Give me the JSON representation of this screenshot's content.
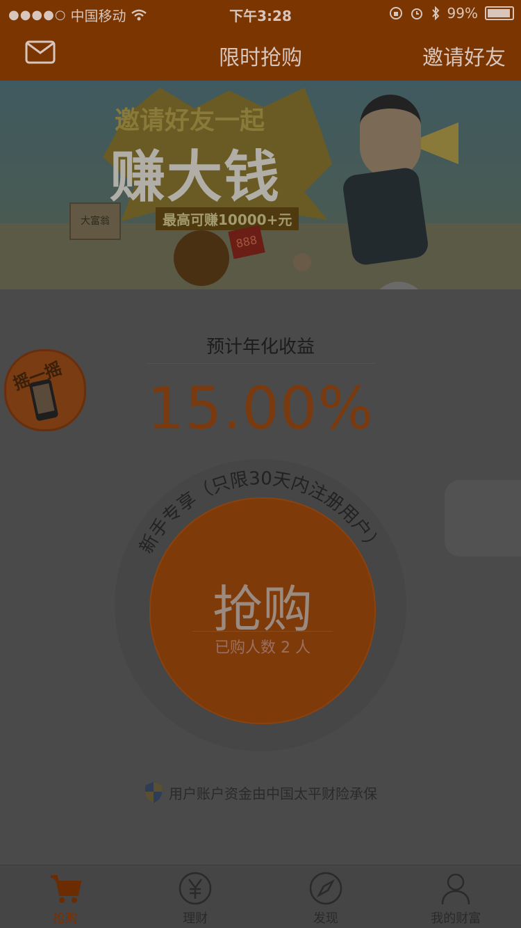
{
  "status_bar": {
    "signal": "●●●●○",
    "carrier": "中国移动",
    "time": "下午3:28",
    "battery_percent": "99%"
  },
  "nav": {
    "title": "限时抢购",
    "right_label": "邀请好友",
    "mail_icon": "mail-icon"
  },
  "banner": {
    "headline_top": "邀请好友一起",
    "headline_main": "赚大钱",
    "subline": "最高可赚10000+元",
    "sign_text": "大富翁",
    "card_text": "888"
  },
  "yield": {
    "label": "预计年化收益",
    "value": "15.00%"
  },
  "shake": {
    "label": "摇一摇"
  },
  "buy": {
    "arc_text": "新手专享（只限30天内注册用户）",
    "button_label": "抢购",
    "buyers": "已购人数 2 人"
  },
  "insurance": {
    "text": "用户账户资金由中国太平财险承保"
  },
  "tabs": [
    {
      "label": "抢购",
      "icon": "cart-icon",
      "active": true
    },
    {
      "label": "理财",
      "icon": "yen-icon",
      "active": false
    },
    {
      "label": "发现",
      "icon": "compass-icon",
      "active": false
    },
    {
      "label": "我的财富",
      "icon": "user-icon",
      "active": false
    }
  ],
  "colors": {
    "accent": "#7a3500",
    "overlay_bg": "#4a4a4a",
    "buy_button": "#7e3a08"
  }
}
